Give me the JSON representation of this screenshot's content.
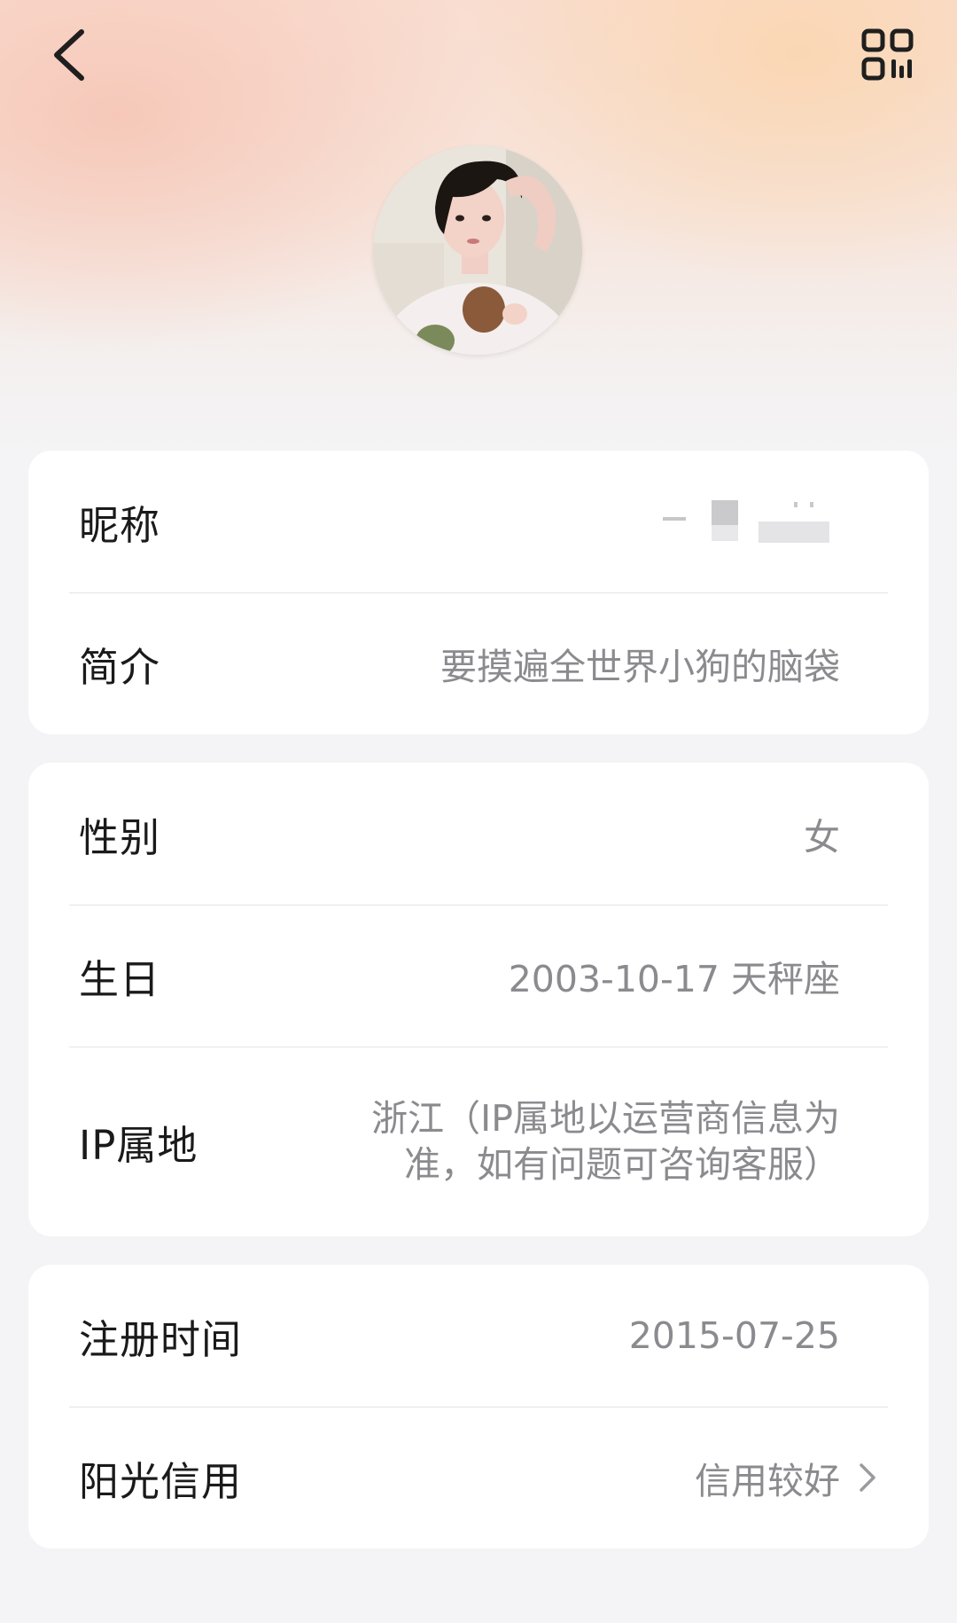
{
  "header": {
    "back_icon": "chevron-left-icon",
    "qr_icon": "qr-code-icon"
  },
  "profile": {
    "avatar": "avatar"
  },
  "sections": {
    "basic": {
      "nickname_label": "昵称",
      "nickname_value": "",
      "bio_label": "简介",
      "bio_value": "要摸遍全世界小狗的脑袋"
    },
    "personal": {
      "gender_label": "性别",
      "gender_value": "女",
      "birthday_label": "生日",
      "birthday_value": "2003-10-17 天秤座",
      "ip_label": "IP属地",
      "ip_value_line1": "浙江（IP属地以运营商信息为",
      "ip_value_line2": "准，如有问题可咨询客服）"
    },
    "account": {
      "register_label": "注册时间",
      "register_value": "2015-07-25",
      "credit_label": "阳光信用",
      "credit_value": "信用较好",
      "credit_icon": "chevron-right-icon"
    }
  },
  "colors": {
    "label": "#1a1a1a",
    "value": "#8b8b8f",
    "card": "#ffffff",
    "page": "#f4f4f6"
  }
}
